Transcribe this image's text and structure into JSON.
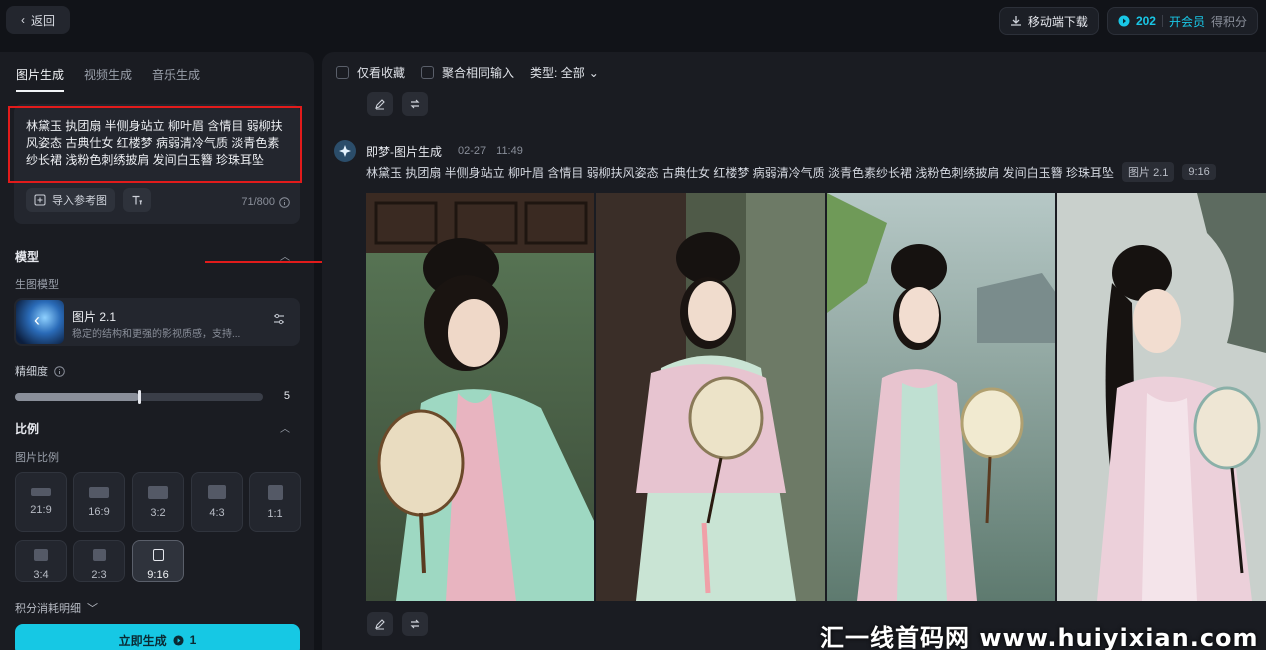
{
  "topbar": {
    "back_label": "返回",
    "download_label": "移动端下载",
    "credits": "202",
    "member_label": "开会员",
    "points_label": "得积分"
  },
  "left": {
    "tabs": [
      {
        "label": "图片生成",
        "active": true
      },
      {
        "label": "视频生成",
        "active": false
      },
      {
        "label": "音乐生成",
        "active": false
      }
    ],
    "prompt": "林黛玉 执团扇 半侧身站立 柳叶眉 含情目 弱柳扶风姿态 古典仕女 红楼梦 病弱清冷气质 淡青色素纱长裙 浅粉色刺绣披肩 发间白玉簪 珍珠耳坠",
    "import_ref_label": "导入参考图",
    "char_count": "71/800",
    "model_section": "模型",
    "gen_model_label": "生图模型",
    "model_name": "图片 2.1",
    "model_desc": "稳定的结构和更强的影视质感，支持...",
    "detail_label": "精细度",
    "detail_value": "5",
    "detail_fraction": 0.5,
    "ratio_section": "比例",
    "ratio_sub": "图片比例",
    "ratios": [
      {
        "label": "21:9"
      },
      {
        "label": "16:9"
      },
      {
        "label": "3:2"
      },
      {
        "label": "4:3"
      },
      {
        "label": "1:1"
      },
      {
        "label": "3:4"
      },
      {
        "label": "2:3"
      },
      {
        "label": "9:16",
        "selected": true
      }
    ],
    "credits_detail": "积分消耗明细",
    "generate_label": "立即生成",
    "generate_cost": "1"
  },
  "right": {
    "filter_fav": "仅看收藏",
    "filter_merge": "聚合相同输入",
    "filter_type": "类型: 全部",
    "entry_title": "即梦-图片生成",
    "entry_date": "02-27",
    "entry_time": "11:49",
    "entry_prompt": "林黛玉 执团扇 半侧身站立 柳叶眉 含情目 弱柳扶风姿态 古典仕女 红楼梦 病弱清冷气质 淡青色素纱长裙 浅粉色刺绣披肩 发间白玉簪 珍珠耳坠",
    "model_tag": "图片 2.1",
    "ratio_tag": "9:16"
  },
  "watermark": "汇一线首码网 www.huiyixian.com",
  "colors": {
    "accent": "#16c8e4",
    "annotation_red": "#e21b1b"
  }
}
